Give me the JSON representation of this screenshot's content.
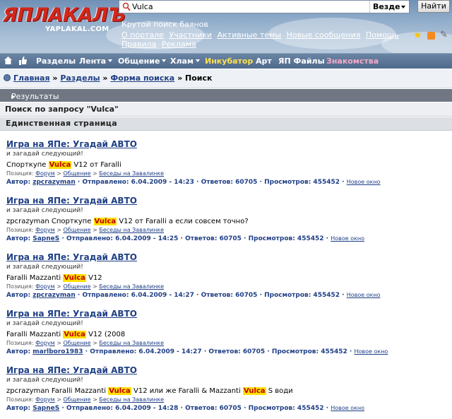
{
  "header": {
    "logo_text": "ЯПЛАКАЛЪ",
    "logo_sub": "YAPLAKAL.COM",
    "search": {
      "value": "Vulca",
      "scope": "Везде",
      "button": "Найти"
    },
    "tagline": "Крутой поиск баянов",
    "links": [
      "О портале",
      "Участники",
      "Активные темы",
      "Новые сообщения",
      "Помощь",
      "Правила",
      "Реклама"
    ]
  },
  "nav": {
    "items": [
      {
        "label": "Разделы"
      },
      {
        "label": "Лента"
      },
      {
        "label": "Общение"
      },
      {
        "label": "Хлам"
      },
      {
        "label": "Инкубатор"
      },
      {
        "label": "Арт"
      },
      {
        "label": "ЯП Файлы"
      },
      {
        "label": "Знакомства"
      }
    ]
  },
  "breadcrumb": {
    "items": [
      "Главная",
      "Разделы",
      "Форма поиска"
    ],
    "current": "Поиск",
    "separator": "»"
  },
  "bars": {
    "results": "Результаты поиска",
    "query": "Поиск по запросу \"Vulca\"",
    "page": "Единственная страница"
  },
  "results": [
    {
      "title": "Игра на ЯПе: Угадай АВТО",
      "subtitle": "и загадай следующий!",
      "text_before": "Спорткупе ",
      "highlight": "Vulca",
      "text_after": " V12 от Faralli",
      "position_label": "Позиция:",
      "position": [
        "Форум",
        "Общение",
        "Беседы на Завалинке"
      ],
      "author_label": "Автор:",
      "author": "zpcrazyman",
      "posted": "Отправлено: 6.04.2009 - 14:23",
      "replies": "Ответов: 60705",
      "views": "Просмотров: 455452",
      "new_window": "Новое окно"
    },
    {
      "title": "Игра на ЯПе: Угадай АВТО",
      "subtitle": "и загадай следующий!",
      "text_before": "zpcrazyman Спорткупе ",
      "highlight": "Vulca",
      "text_after": " V12 от Faralli а если совсем точно?",
      "position_label": "Позиция:",
      "position": [
        "Форум",
        "Общение",
        "Беседы на Завалинке"
      ],
      "author_label": "Автор:",
      "author": "SapneS",
      "posted": "Отправлено: 6.04.2009 - 14:25",
      "replies": "Ответов: 60705",
      "views": "Просмотров: 455452",
      "new_window": "Новое окно"
    },
    {
      "title": "Игра на ЯПе: Угадай АВТО",
      "subtitle": "и загадай следующий!",
      "text_before": "Faralli Mazzanti ",
      "highlight": "Vulca",
      "text_after": " V12",
      "position_label": "Позиция:",
      "position": [
        "Форум",
        "Общение",
        "Беседы на Завалинке"
      ],
      "author_label": "Автор:",
      "author": "zpcrazyman",
      "posted": "Отправлено: 6.04.2009 - 14:27",
      "replies": "Ответов: 60705",
      "views": "Просмотров: 455452",
      "new_window": "Новое окно"
    },
    {
      "title": "Игра на ЯПе: Угадай АВТО",
      "subtitle": "и загадай следующий!",
      "text_before": "Faralli Mazzanti ",
      "highlight": "Vulca",
      "text_after": " V12 (2008",
      "position_label": "Позиция:",
      "position": [
        "Форум",
        "Общение",
        "Беседы на Завалинке"
      ],
      "author_label": "Автор:",
      "author": "marlboro1983",
      "posted": "Отправлено: 6.04.2009 - 14:27",
      "replies": "Ответов: 60705",
      "views": "Просмотров: 455452",
      "new_window": "Новое окно"
    },
    {
      "title": "Игра на ЯПе: Угадай АВТО",
      "subtitle": "и загадай следующий!",
      "text_before": "zpcrazyman Faralli Mazzanti ",
      "highlight": "Vulca",
      "text_mid": " V12 или же Faralli & Mazzanti ",
      "highlight2": "Vulca",
      "text_after": " S води",
      "position_label": "Позиция:",
      "position": [
        "Форум",
        "Общение",
        "Беседы на Завалинке"
      ],
      "author_label": "Автор:",
      "author": "SapneS",
      "posted": "Отправлено: 6.04.2009 - 14:28",
      "replies": "Ответов: 60705",
      "views": "Просмотров: 455452",
      "new_window": "Новое окно"
    }
  ]
}
